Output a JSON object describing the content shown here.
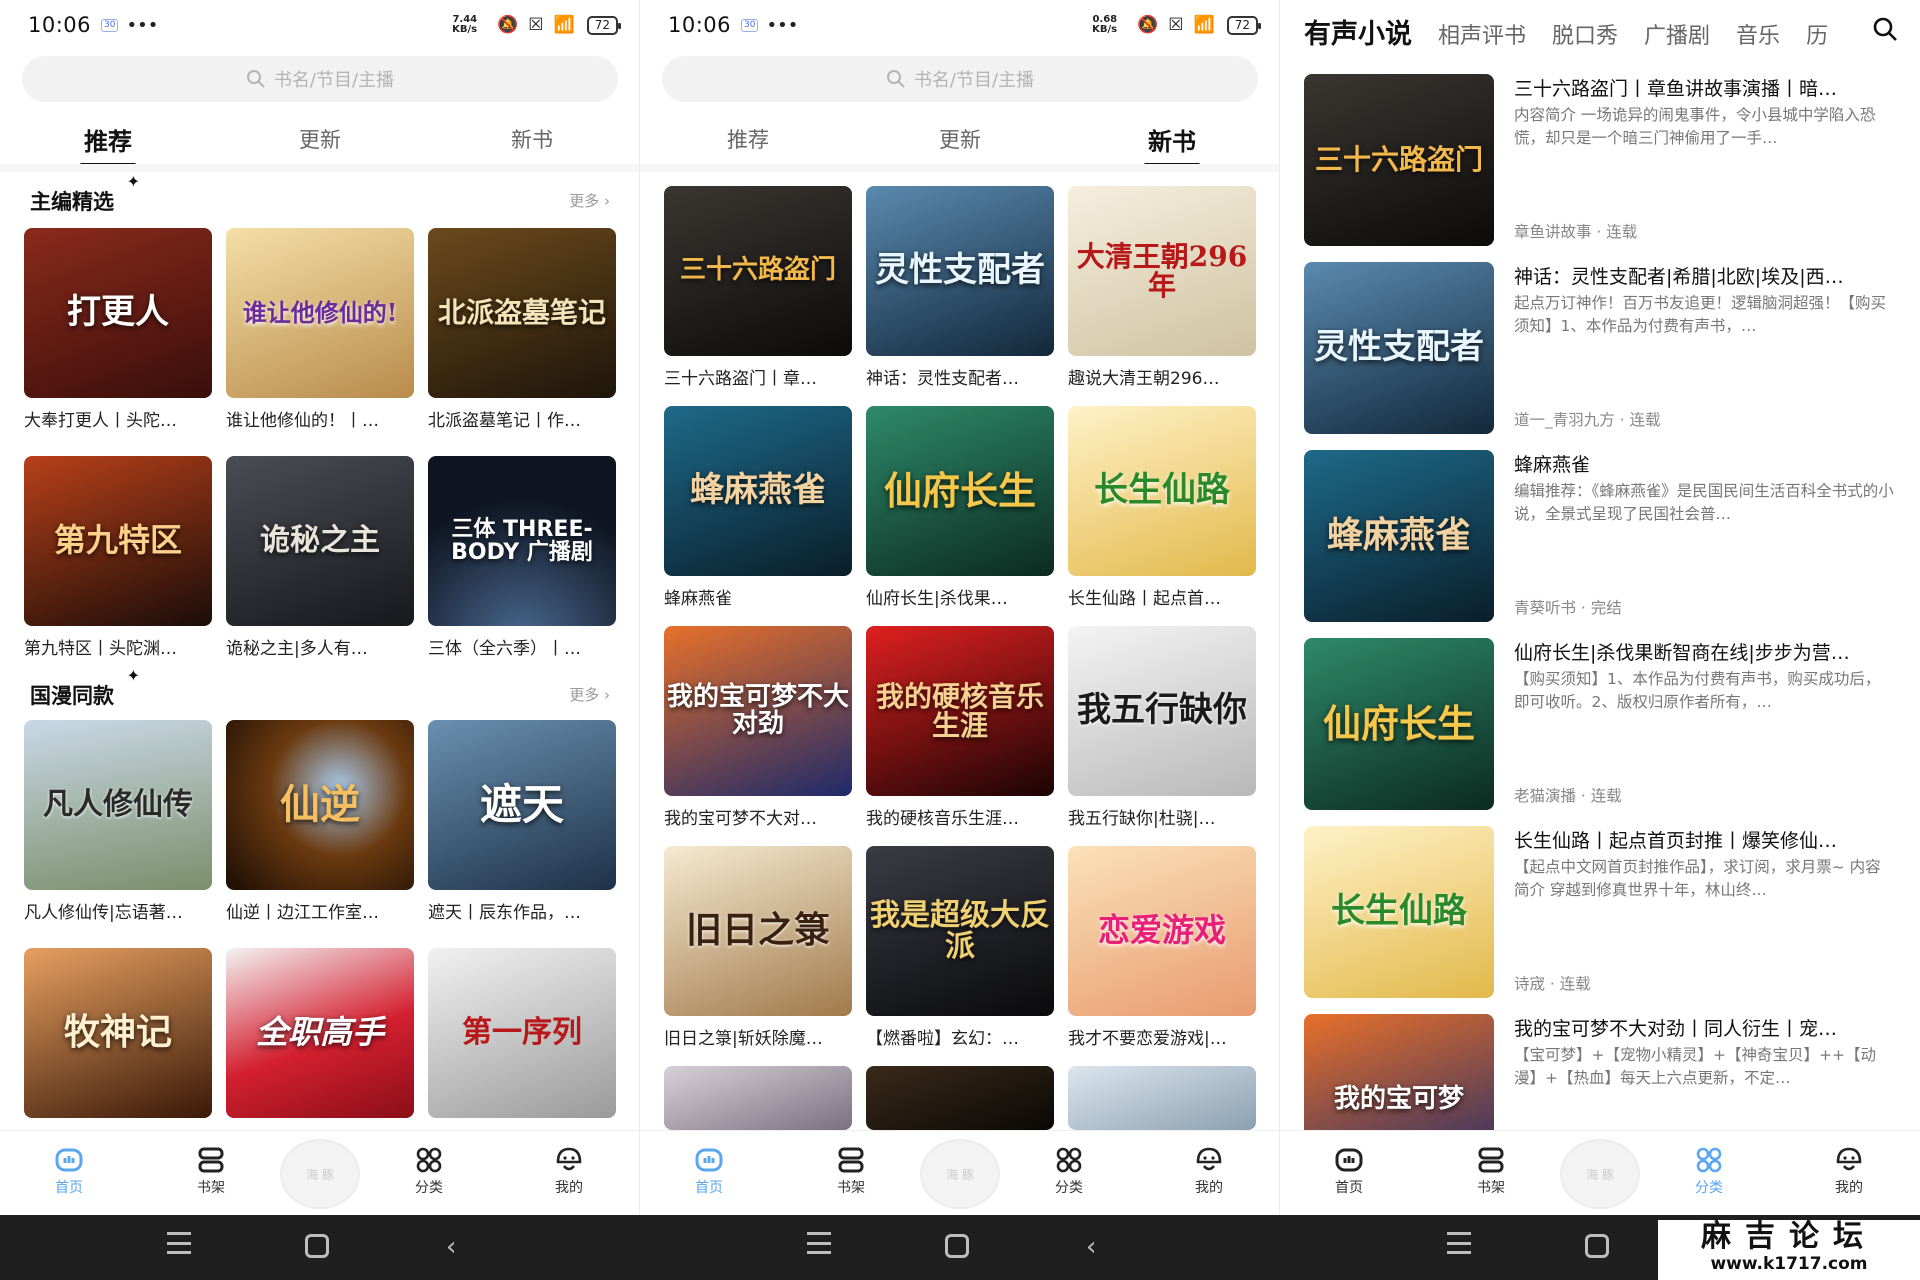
{
  "status": {
    "time": "10:06",
    "mini_badge": "30",
    "speed_p1_top": "7.44",
    "speed_p1_bot": "KB/s",
    "speed_p2_top": "0.68",
    "speed_p2_bot": "KB/s",
    "battery": "72"
  },
  "search": {
    "placeholder": "书名/节目/主播"
  },
  "tabs": [
    "推荐",
    "更新",
    "新书"
  ],
  "panel1": {
    "section1": {
      "title": "主编精选",
      "more": "更多 ›"
    },
    "section2": {
      "title": "国漫同款",
      "more": "更多 ›"
    },
    "row1": [
      {
        "cover": "打更人",
        "caption": "大奉打更人丨头陀…",
        "color": "#6b1d16"
      },
      {
        "cover": "谁让他修仙的!",
        "caption": "谁让他修仙的！丨…",
        "color": "#c9a86a"
      },
      {
        "cover": "北派盗墓笔记",
        "caption": "北派盗墓笔记丨作…",
        "color": "#3a2a12"
      }
    ],
    "row2": [
      {
        "cover": "第九特区",
        "caption": "第九特区丨头陀渊…",
        "color": "#2a1a14"
      },
      {
        "cover": "诡秘之主",
        "caption": "诡秘之主|多人有…",
        "color": "#2b2d33"
      },
      {
        "cover": "三体 THREE-BODY 广播剧",
        "caption": "三体（全六季）丨…",
        "color": "#1a2330"
      }
    ],
    "row3": [
      {
        "cover": "凡人修仙传",
        "caption": "凡人修仙传|忘语著…",
        "color": "#8aa2b8"
      },
      {
        "cover": "仙逆",
        "caption": "仙逆丨边江工作室…",
        "color": "#4a2a10"
      },
      {
        "cover": "遮天",
        "caption": "遮天丨辰东作品，…",
        "color": "#3d5f80"
      }
    ],
    "row4": [
      {
        "cover": "牧神记",
        "caption": "",
        "color": "#7a3a14"
      },
      {
        "cover": "全职高手",
        "caption": "",
        "color": "#c41e2a"
      },
      {
        "cover": "第一序列",
        "caption": "",
        "color": "#dcdcdc"
      }
    ]
  },
  "panel2": {
    "row1": [
      {
        "cover": "三十六路盗门",
        "caption": "三十六路盗门丨章…",
        "color": "#1c1a18"
      },
      {
        "cover": "灵性支配者",
        "caption": "神话：灵性支配者…",
        "color": "#2e5a7a"
      },
      {
        "cover": "大清王朝296年",
        "caption": "趣说大清王朝296…",
        "color": "#efe6d2"
      }
    ],
    "row2": [
      {
        "cover": "蜂麻燕雀",
        "caption": "蜂麻燕雀",
        "color": "#14405a"
      },
      {
        "cover": "仙府长生",
        "caption": "仙府长生|杀伐果…",
        "color": "#1c5a48"
      },
      {
        "cover": "长生仙路",
        "caption": "长生仙路丨起点首…",
        "color": "#e7c66a"
      }
    ],
    "row3": [
      {
        "cover": "我的宝可梦不大对劲",
        "caption": "我的宝可梦不大对…",
        "color": "#2c4a8a"
      },
      {
        "cover": "我的硬核音乐生涯",
        "caption": "我的硬核音乐生涯…",
        "color": "#b51616"
      },
      {
        "cover": "我五行缺你",
        "caption": "我五行缺你|杜骁|…",
        "color": "#e8e8e8"
      }
    ],
    "row4": [
      {
        "cover": "旧日之箓",
        "caption": "旧日之箓|斩妖除魔…",
        "color": "#e9dcc6"
      },
      {
        "cover": "我是超级大反派",
        "caption": "【燃番啦】玄幻：…",
        "color": "#17181c"
      },
      {
        "cover": "恋爱游戏",
        "caption": "我才不要恋爱游戏|…",
        "color": "#f0c89a"
      }
    ]
  },
  "panel3": {
    "cat_tabs": [
      "有声小说",
      "相声评书",
      "脱口秀",
      "广播剧",
      "音乐",
      "历"
    ],
    "items": [
      {
        "cover": "三十六路盗门",
        "title": "三十六路盗门丨章鱼讲故事演播丨暗…",
        "desc": "内容简介 一场诡异的闹鬼事件，令小县城中学陷入恐慌，却只是一个暗三门神偷用了一手…",
        "meta": "章鱼讲故事 · 连载",
        "color": "#1c1a18"
      },
      {
        "cover": "灵性支配者",
        "title": "神话：灵性支配者|希腊|北欧|埃及|西…",
        "desc": "起点万订神作！百万书友追更！逻辑脑洞超强！【购买须知】1、本作品为付费有声书，…",
        "meta": "道一_青羽九方 · 连载",
        "color": "#2e5a7a"
      },
      {
        "cover": "蜂麻燕雀",
        "title": "蜂麻燕雀",
        "desc": "编辑推荐：《蜂麻燕雀》是民国民间生活百科全书式的小说，全景式呈现了民国社会普…",
        "meta": "青葵听书 · 完结",
        "color": "#14405a"
      },
      {
        "cover": "仙府长生",
        "title": "仙府长生|杀伐果断智商在线|步步为营…",
        "desc": "【购买须知】1、本作品为付费有声书，购买成功后，即可收听。2、版权归原作者所有，…",
        "meta": "老猫演播 · 连载",
        "color": "#1c5a48"
      },
      {
        "cover": "长生仙路",
        "title": "长生仙路丨起点首页封推丨爆笑修仙…",
        "desc": "【起点中文网首页封推作品】，求订阅，求月票~ 内容简介 穿越到修真世界十年，林山终…",
        "meta": "诗宬 · 连载",
        "color": "#e7c66a"
      },
      {
        "cover": "我的宝可梦",
        "title": "我的宝可梦不大对劲丨同人衍生丨宠…",
        "desc": "【宝可梦】+【宠物小精灵】+【神奇宝贝】++【动漫】+【热血】每天上六点更新，不定…",
        "meta": "",
        "color": "#2c4a8a"
      }
    ]
  },
  "nav": {
    "items": [
      "首页",
      "书架",
      "分类",
      "我的"
    ],
    "center": "海 豚"
  },
  "watermark": {
    "line1": "麻吉论坛",
    "line2": "www.k1717.com"
  }
}
